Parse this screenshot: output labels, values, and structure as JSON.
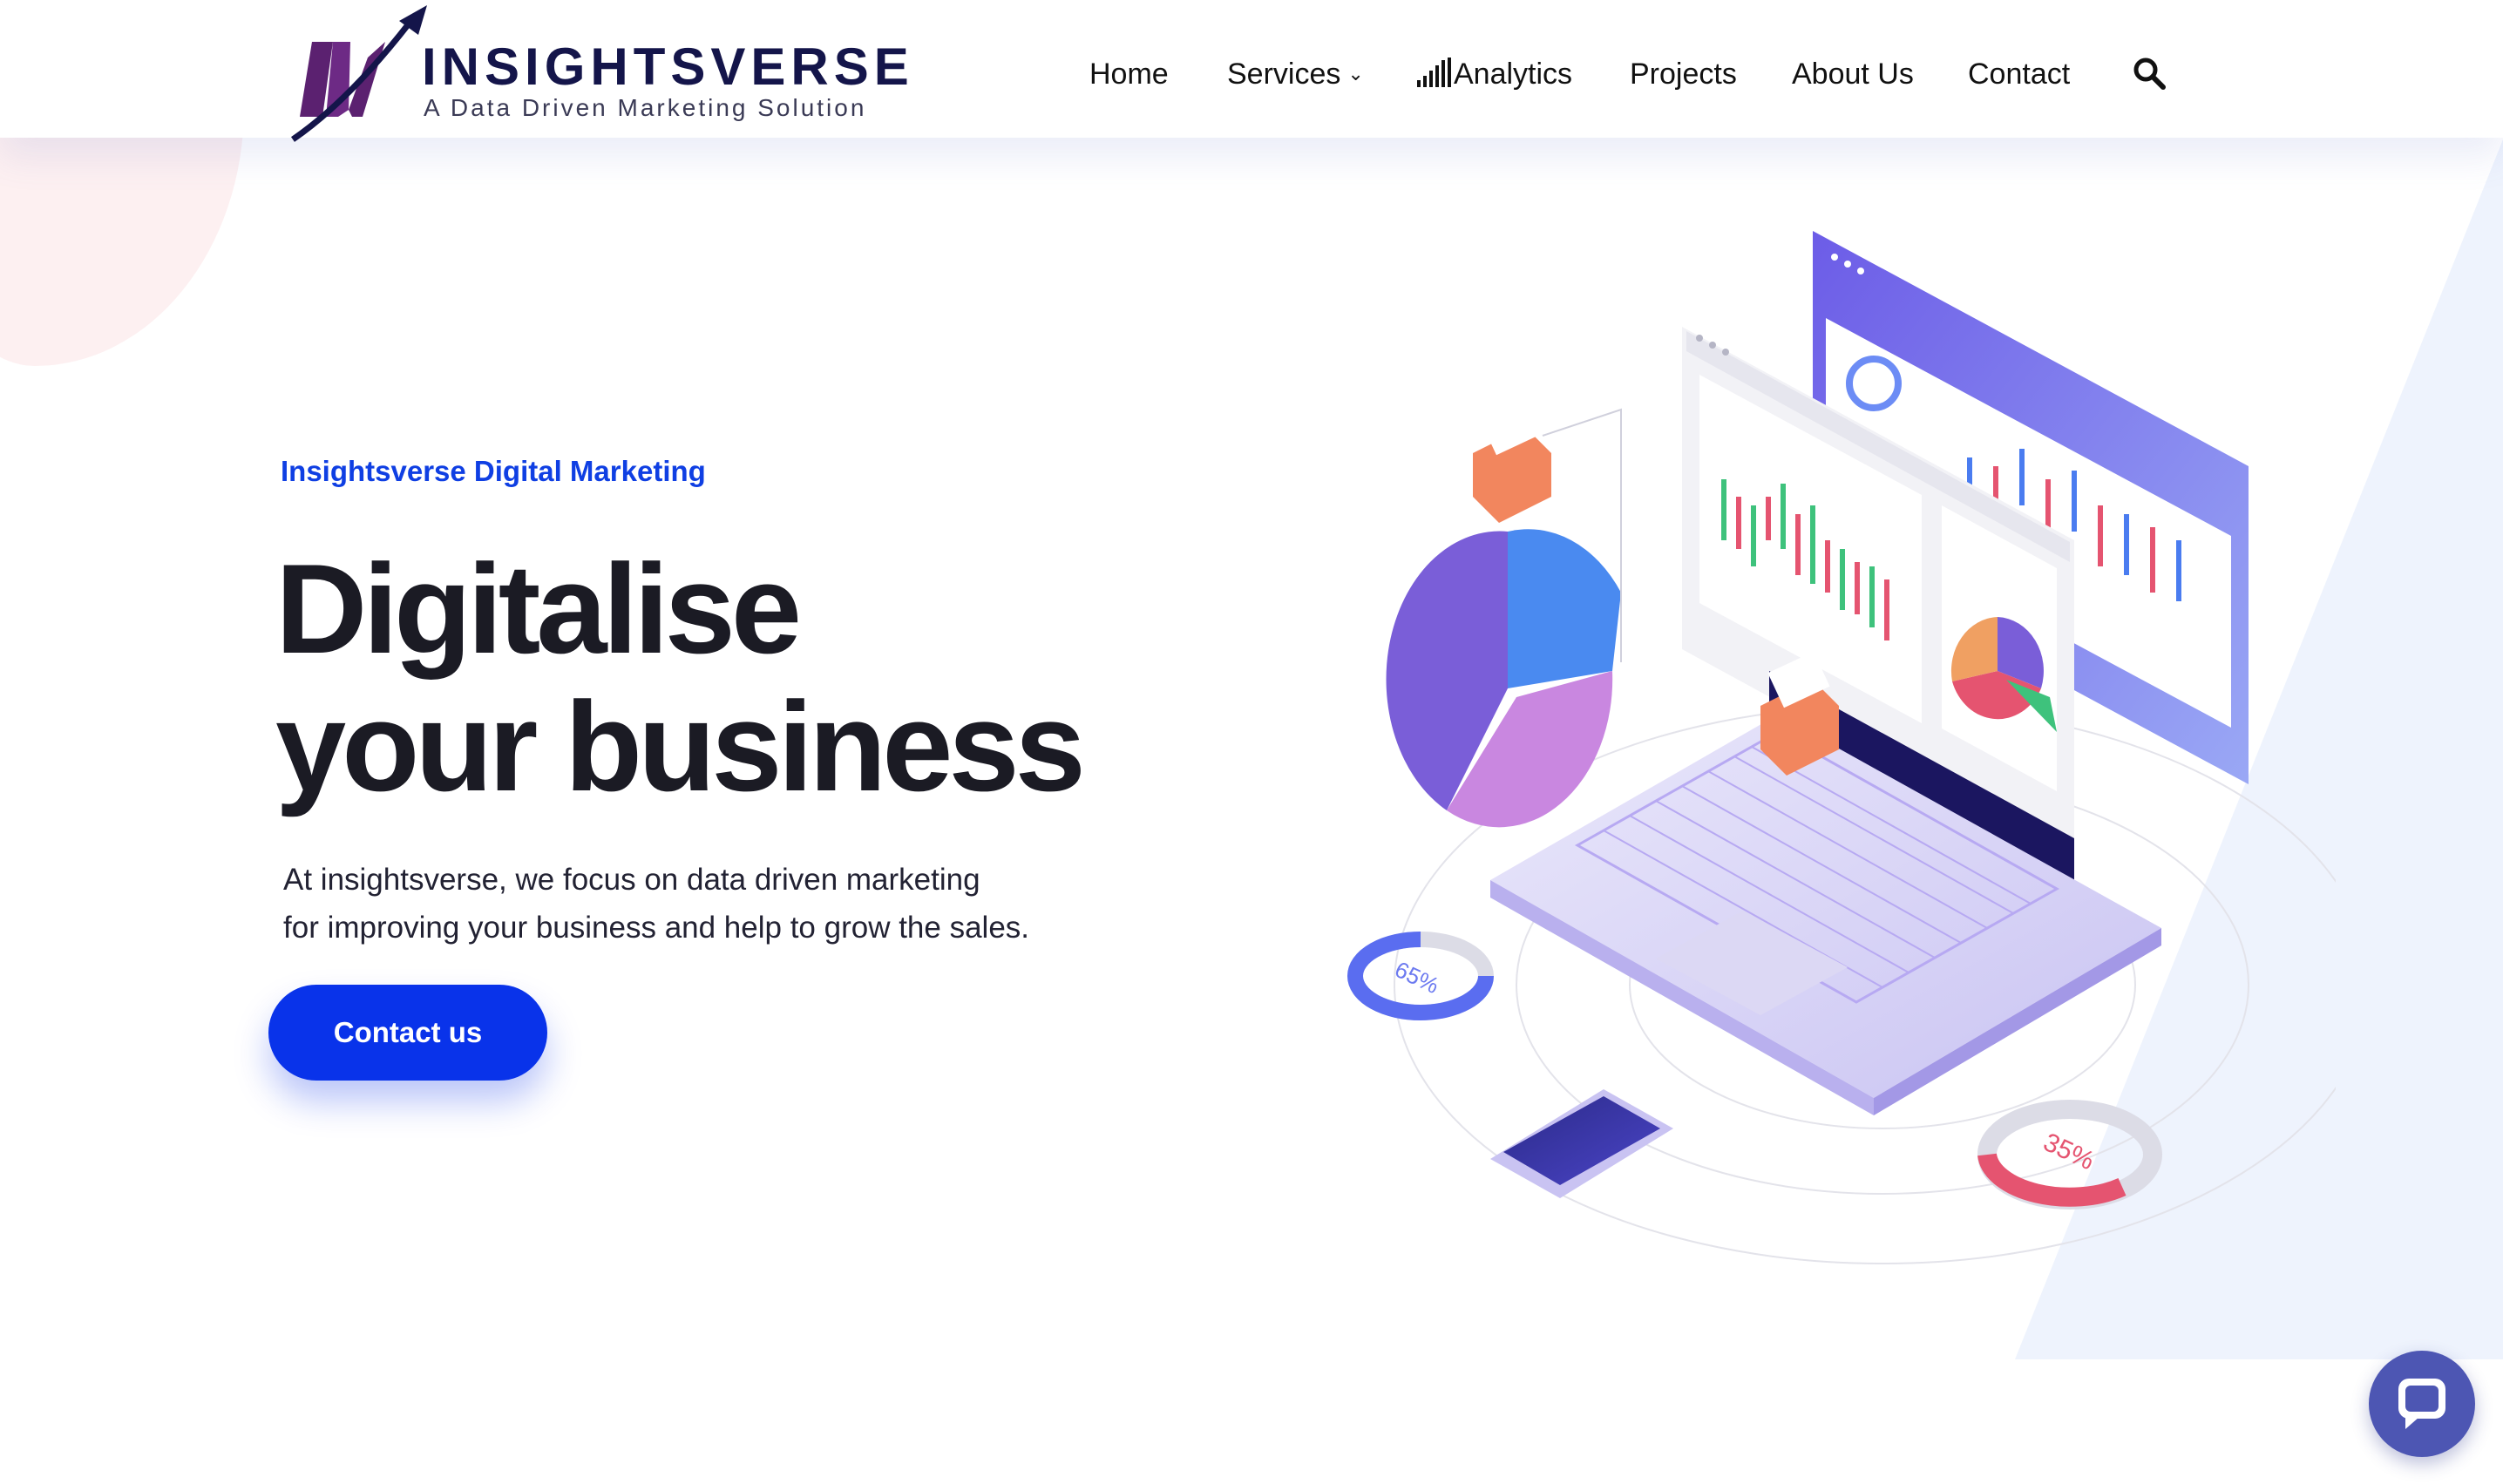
{
  "brand": {
    "name": "INSIGHTSVERSE",
    "tagline": "A Data Driven Marketing Solution",
    "colors": {
      "navy": "#14154a",
      "purple": "#5b2170",
      "accent": "#0933ea"
    }
  },
  "nav": {
    "items": [
      {
        "label": "Home"
      },
      {
        "label": "Services",
        "icon": "chevron-down-icon"
      },
      {
        "label": "Analytics",
        "icon": "signal-bars-icon"
      },
      {
        "label": "Projects"
      },
      {
        "label": "About Us"
      },
      {
        "label": "Contact"
      }
    ],
    "search_icon": "search-icon"
  },
  "hero": {
    "eyebrow": "Insightsverse Digital Marketing",
    "headline_line1": "Digitalise",
    "headline_line2": "your business",
    "lead_line1": "At insightsverse, we focus on data driven marketing",
    "lead_line2": "for improving your business and help to grow the sales.",
    "cta_label": "Contact us"
  },
  "illustration": {
    "donut_left_label": "65%",
    "donut_right_label": "35%"
  },
  "chat_widget": {
    "icon": "chat-bubble-icon"
  }
}
